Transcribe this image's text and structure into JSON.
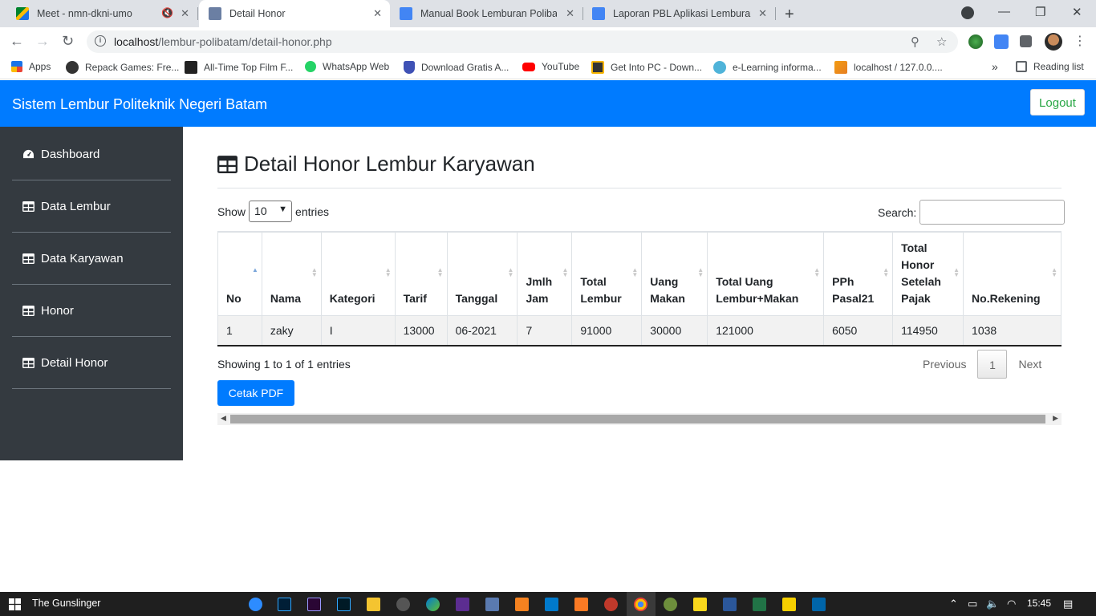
{
  "browser": {
    "tabs": [
      {
        "title": "Meet - nmn-dkni-umo",
        "active": false,
        "muted": true
      },
      {
        "title": "Detail Honor",
        "active": true
      },
      {
        "title": "Manual Book Lemburan Polibatam",
        "active": false
      },
      {
        "title": "Laporan PBL Aplikasi Lemburan",
        "active": false
      }
    ],
    "url_host": "localhost",
    "url_path": "/lembur-polibatam/detail-honor.php",
    "bookmarks": [
      {
        "label": "Apps",
        "color": "#1a73e8"
      },
      {
        "label": "Repack Games: Fre...",
        "color": "#333333"
      },
      {
        "label": "All-Time Top Film F...",
        "color": "#222222"
      },
      {
        "label": "WhatsApp Web",
        "color": "#25d366"
      },
      {
        "label": "Download Gratis A...",
        "color": "#3f51b5"
      },
      {
        "label": "YouTube",
        "color": "#ff0000"
      },
      {
        "label": "Get Into PC - Down...",
        "color": "#333333"
      },
      {
        "label": "e-Learning informa...",
        "color": "#4fb3d9"
      },
      {
        "label": "localhost / 127.0.0....",
        "color": "#f39c12"
      }
    ],
    "reading_list": "Reading list",
    "more_bookmarks": "»"
  },
  "app": {
    "brand": "Sistem Lembur Politeknik Negeri Batam",
    "logout": "Logout",
    "accent": "#007bff",
    "sidebar": [
      {
        "label": "Dashboard",
        "icon": "tachometer-icon"
      },
      {
        "label": "Data Lembur",
        "icon": "table-icon"
      },
      {
        "label": "Data Karyawan",
        "icon": "table-icon"
      },
      {
        "label": "Honor",
        "icon": "table-icon"
      },
      {
        "label": "Detail Honor",
        "icon": "table-icon"
      }
    ]
  },
  "main": {
    "title": "Detail Honor Lembur Karyawan",
    "show_label": "Show",
    "entries_value": "10",
    "entries_label": "entries",
    "search_label": "Search:",
    "columns": [
      "No",
      "Nama",
      "Kategori",
      "Tarif",
      "Tanggal",
      "Jmlh Jam",
      "Total Lembur",
      "Uang Makan",
      "Total Uang Lembur+Makan",
      "PPh Pasal21",
      "Total Honor Setelah Pajak",
      "No.Rekening"
    ],
    "rows": [
      [
        "1",
        "zaky",
        "I",
        "13000",
        "06-2021",
        "7",
        "91000",
        "30000",
        "121000",
        "6050",
        "114950",
        "1038"
      ]
    ],
    "info": "Showing 1 to 1 of 1 entries",
    "pager": {
      "previous": "Previous",
      "current": "1",
      "next": "Next"
    },
    "cetak": "Cetak PDF"
  },
  "taskbar": {
    "label": "The Gunslinger",
    "time": "15:45"
  }
}
